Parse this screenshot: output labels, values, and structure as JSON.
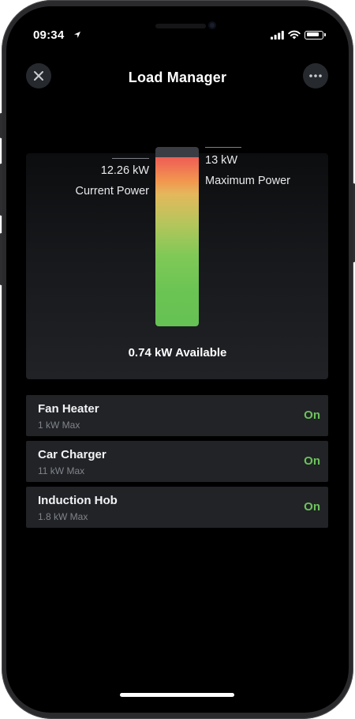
{
  "status_bar": {
    "time": "09:34"
  },
  "header": {
    "title": "Load Manager"
  },
  "gauge": {
    "current_value": "12.26 kW",
    "current_label": "Current Power",
    "max_value": "13 kW",
    "max_label": "Maximum Power",
    "fill_fraction": 0.943,
    "available": "0.74 kW Available"
  },
  "devices": [
    {
      "name": "Fan Heater",
      "max": "1 kW Max",
      "state": "On"
    },
    {
      "name": "Car Charger",
      "max": "11 kW Max",
      "state": "On"
    },
    {
      "name": "Induction Hob",
      "max": "1.8 kW Max",
      "state": "On"
    }
  ],
  "colors": {
    "accent_on": "#6cc35a",
    "background": "#000000",
    "row": "#212327"
  },
  "icons": [
    "location-arrow-icon",
    "signal-icon",
    "wifi-icon",
    "battery-icon",
    "close-icon",
    "more-icon"
  ]
}
